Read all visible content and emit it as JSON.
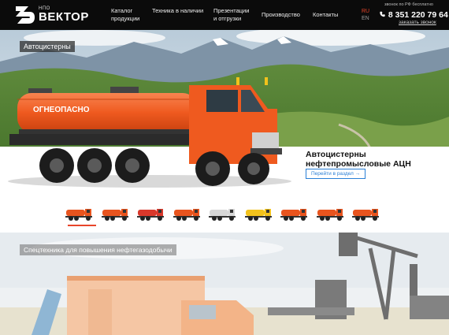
{
  "header": {
    "logo_small": "НПО",
    "logo_name": "ВЕКТОР",
    "nav": [
      {
        "label": "Каталог\nпродукции"
      },
      {
        "label": "Техника в наличии"
      },
      {
        "label": "Презентации\nи отгрузки"
      },
      {
        "label": "Производство"
      },
      {
        "label": "Контакты"
      }
    ],
    "lang_ru": "RU",
    "lang_en": "EN",
    "free_call": "звонок по РФ бесплатно",
    "phone": "8 351 220 79 64",
    "order_call": "заказать звонок"
  },
  "hero": {
    "tag": "Автоцистерны",
    "tank_text": "ОГНЕОПАСНО",
    "title": "Автоцистерны нефтепромысловые АЦН",
    "button": "Перейти в раздел →"
  },
  "thumbnails": {
    "colors": [
      "#e8541e",
      "#e8541e",
      "#d9382b",
      "#e8541e",
      "#d6d6d6",
      "#f2c21c",
      "#e8541e",
      "#e8541e",
      "#e8541e"
    ],
    "active_index": 0
  },
  "section2": {
    "tag": "Спецтехника для повышения нефтегазодобычи"
  },
  "colors": {
    "accent": "#e8452a",
    "link": "#2a7fd6",
    "header_bg": "#0b0b0b",
    "truck_orange": "#ef5a1f"
  }
}
